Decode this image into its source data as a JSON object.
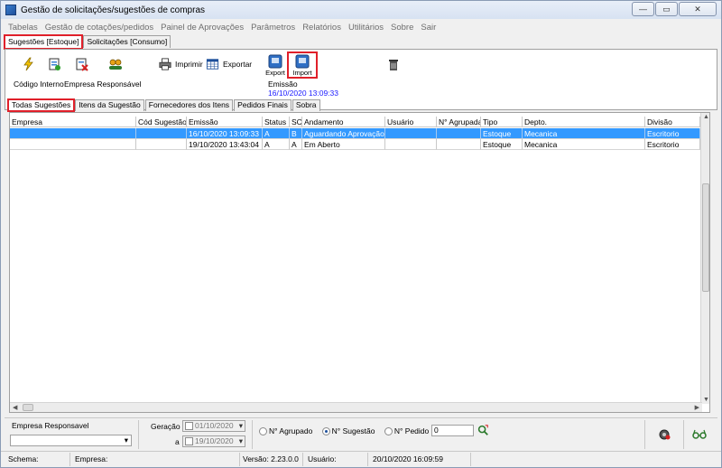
{
  "window": {
    "title": "Gestão de solicitações/sugestões de compras",
    "minimize": "—",
    "maximize": "▭",
    "close": "✕"
  },
  "menu": [
    "Tabelas",
    "Gestão de cotações/pedidos",
    "Painel de Aprovações",
    "Parâmetros",
    "Relatórios",
    "Utilitários",
    "Sobre",
    "Sair"
  ],
  "top_tabs": [
    "Sugestões [Estoque]",
    "Solicitações [Consumo]"
  ],
  "toolbar": {
    "print_label": "Imprimir",
    "export_label": "Exportar",
    "export_small_label": "Export",
    "import_small_label": "Import"
  },
  "header_fields": {
    "codigo_label": "Código Interno",
    "empresa_label": "Empresa Responsável",
    "emissao_label": "Emissão",
    "emissao_value": "16/10/2020 13:09:33"
  },
  "inner_tabs": [
    "Todas Sugestões",
    "Itens da Sugestão",
    "Fornecedores dos Itens",
    "Pedidos Finais",
    "Sobra"
  ],
  "grid": {
    "columns": [
      "Empresa",
      "Cód Sugestão",
      "Emissão",
      "Status",
      "SC",
      "Andamento",
      "Usuário",
      "N° Agrupada",
      "Tipo",
      "Depto.",
      "Divisão"
    ],
    "rows": [
      [
        "",
        "",
        "16/10/2020 13:09:33",
        "A",
        "B",
        "Aguardando Aprovação",
        "",
        "",
        "Estoque",
        "Mecanica",
        "Escritorio"
      ],
      [
        "",
        "",
        "19/10/2020 13:43:04",
        "A",
        "A",
        "Em Aberto",
        "",
        "",
        "Estoque",
        "Mecanica",
        "Escritorio"
      ]
    ],
    "selected_row": 0
  },
  "filter": {
    "empresa_label": "Empresa Responsavel",
    "empresa_value": "",
    "geracao_label": "Geração",
    "date_from": "01/10/2020",
    "a_label": "a",
    "date_to": "19/10/2020",
    "radio_agrupado": "N° Agrupado",
    "radio_sugestao": "N° Sugestão",
    "radio_pedido": "N° Pedido",
    "number_value": "0"
  },
  "status": {
    "schema": "Schema:",
    "empresa": "Empresa:",
    "versao": "Versão: 2.23.0.0",
    "usuario": "Usuário:",
    "datetime": "20/10/2020 16:09:59"
  },
  "colors": {
    "selection": "#3399ff",
    "link_blue": "#1a1aff",
    "highlight_box": "#e0202a"
  }
}
